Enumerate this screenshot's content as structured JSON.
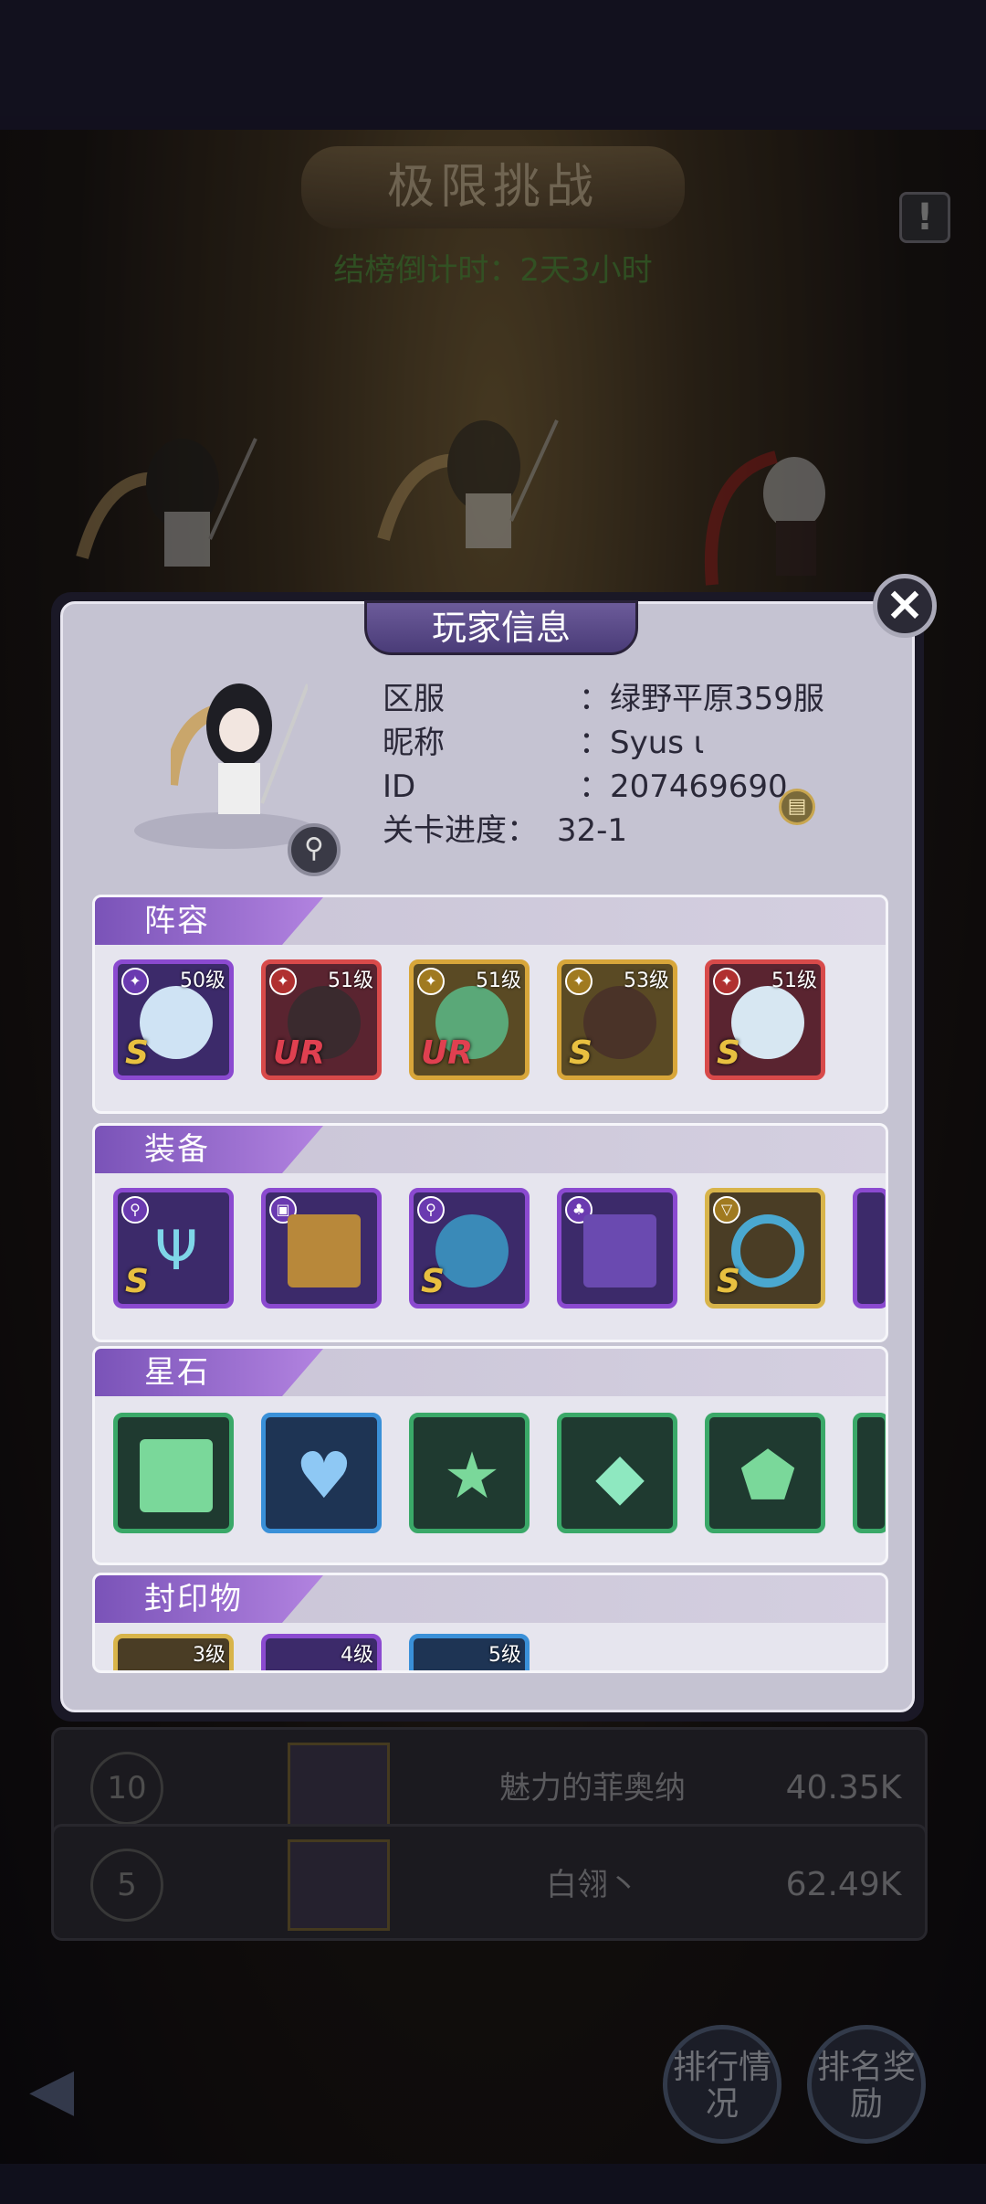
{
  "background": {
    "title": "极限挑战",
    "countdown": "结榜倒计时：2天3小时",
    "info_button": "!",
    "ranking_rows": [
      {
        "rank": "10",
        "name": "魅力的菲奥纳",
        "score": "40.35K"
      },
      {
        "rank": "5",
        "name": "白翎丶",
        "score": "62.49K"
      }
    ],
    "buttons": {
      "ranking_status": "排行情况",
      "rank_rewards": "排名奖励"
    }
  },
  "modal": {
    "title": "玩家信息",
    "close_icon": "×",
    "player": {
      "server_label": "区服",
      "server_value": "：绿野平原359服",
      "nickname_label": "昵称",
      "nickname_value": "：Syus ι",
      "id_label": "ID",
      "id_value": "：207469690",
      "progress_label": "关卡进度：",
      "progress_value": "32-1"
    },
    "sections": {
      "lineup": "阵容",
      "equipment": "装备",
      "starstone": "星石",
      "seal": "封印物"
    },
    "lineup": [
      {
        "level": "50级",
        "grade": "S"
      },
      {
        "level": "51级",
        "grade": "UR"
      },
      {
        "level": "51级",
        "grade": "UR"
      },
      {
        "level": "53级",
        "grade": "S"
      },
      {
        "level": "51级",
        "grade": "S"
      }
    ],
    "equipment": [
      {
        "grade": "S",
        "icon": "trident-icon"
      },
      {
        "grade": "",
        "icon": "book-icon"
      },
      {
        "grade": "S",
        "icon": "helmet-icon"
      },
      {
        "grade": "",
        "icon": "armor-skirt-icon"
      },
      {
        "grade": "S",
        "icon": "ring-icon"
      }
    ],
    "starstones": [
      {
        "icon": "square-gem-icon"
      },
      {
        "icon": "heart-gem-icon"
      },
      {
        "icon": "star-gem-icon"
      },
      {
        "icon": "diamond-gem-icon"
      },
      {
        "icon": "shield-gem-icon"
      }
    ],
    "seals": [
      {
        "level": "3级"
      },
      {
        "level": "4级"
      },
      {
        "level": "5级"
      }
    ]
  },
  "colors": {
    "accent": "#7a53b8",
    "ur": "#e04050",
    "s_grade": "#e8c040"
  }
}
